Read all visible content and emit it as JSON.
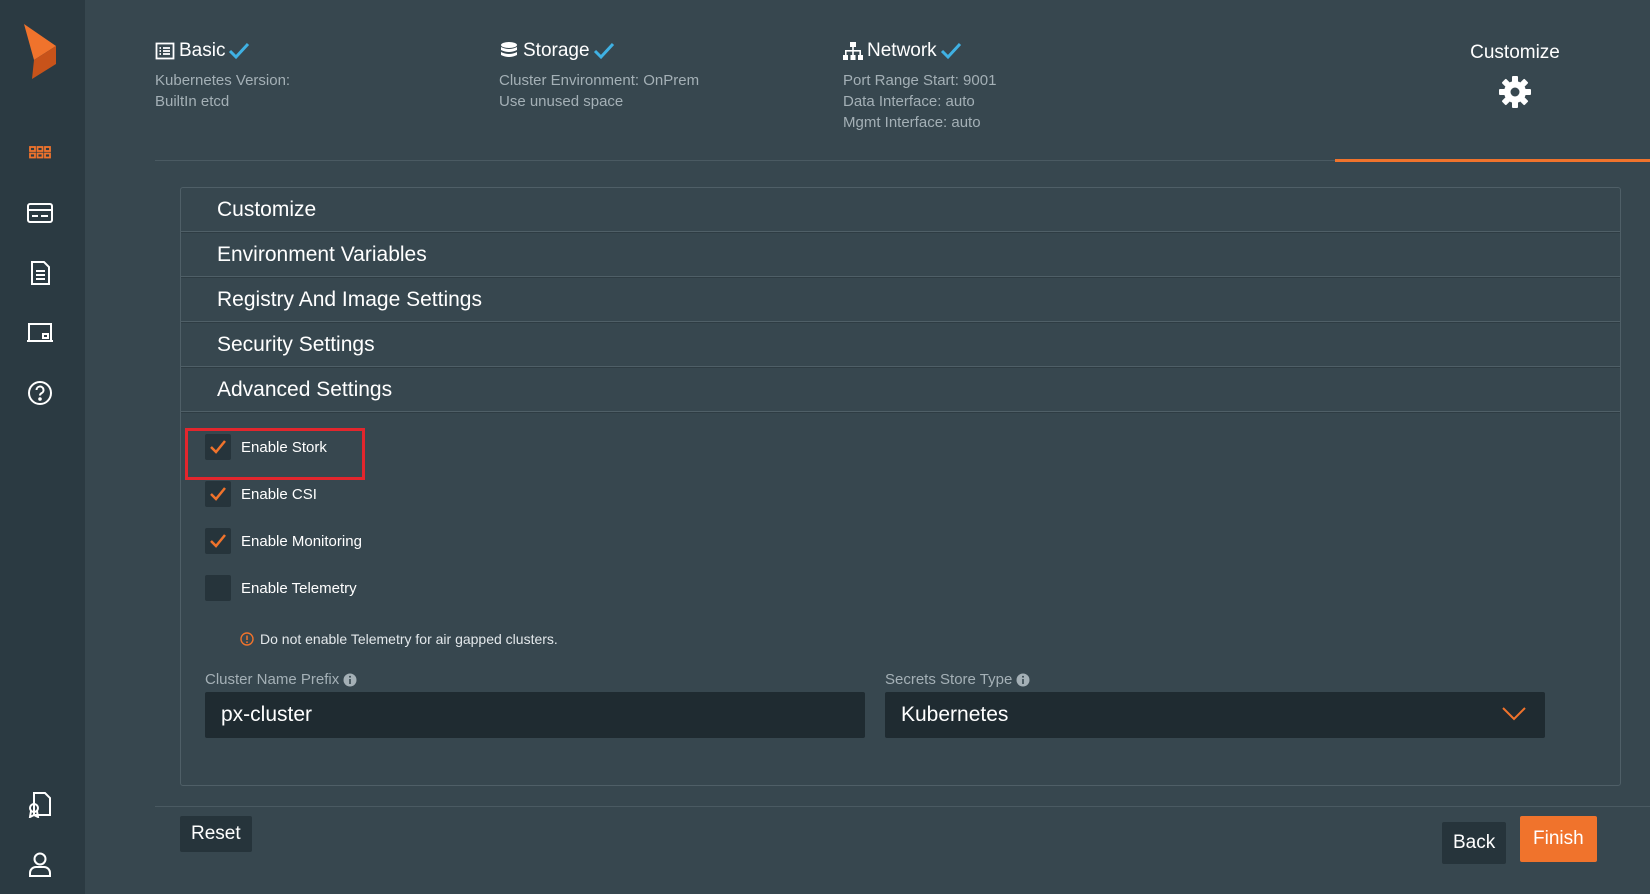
{
  "sidebar": {
    "icons": [
      "portworx-logo",
      "grid-icon",
      "card-icon",
      "document-icon",
      "monitor-icon",
      "help-icon",
      "license-icon",
      "user-icon"
    ]
  },
  "steps": [
    {
      "title": "Basic",
      "lines": [
        "Kubernetes Version:",
        "BuiltIn etcd"
      ]
    },
    {
      "title": "Storage",
      "lines": [
        "Cluster Environment: OnPrem",
        "Use unused space"
      ]
    },
    {
      "title": "Network",
      "lines": [
        "Port Range Start: 9001",
        "Data Interface: auto",
        "Mgmt Interface: auto"
      ]
    },
    {
      "title": "Customize"
    }
  ],
  "accordion": [
    "Customize",
    "Environment Variables",
    "Registry And Image Settings",
    "Security Settings",
    "Advanced Settings"
  ],
  "advanced": {
    "checkboxes": [
      {
        "label": "Enable Stork",
        "checked": true
      },
      {
        "label": "Enable CSI",
        "checked": true
      },
      {
        "label": "Enable Monitoring",
        "checked": true
      },
      {
        "label": "Enable Telemetry",
        "checked": false
      }
    ],
    "telemetry_warning": "Do not enable Telemetry for air gapped clusters.",
    "cluster_prefix_label": "Cluster Name Prefix",
    "cluster_prefix_value": "px-cluster",
    "secrets_label": "Secrets Store Type",
    "secrets_value": "Kubernetes"
  },
  "buttons": {
    "reset": "Reset",
    "back": "Back",
    "finish": "Finish"
  },
  "colors": {
    "accent": "#f0732c",
    "check_blue": "#3fb1e3",
    "highlight_red": "#e3262d"
  }
}
